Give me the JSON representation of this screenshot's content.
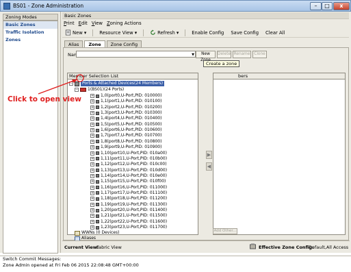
{
  "window": {
    "title": "BS01 - Zone Administration",
    "min_label": "–",
    "max_label": "□",
    "close_label": "x"
  },
  "left_panel": {
    "header": "Zoning Modes",
    "items": [
      {
        "label": "Basic Zones"
      },
      {
        "label": "Traffic Isolation Zones"
      }
    ]
  },
  "right_panel": {
    "header": "Basic Zones",
    "menu": [
      "Print",
      "Edit",
      "View",
      "Zoning Actions"
    ],
    "toolbar": {
      "new": "New",
      "resource_view": "Resource View",
      "refresh": "Refresh",
      "enable_config": "Enable Config",
      "save_config": "Save Config",
      "clear_all": "Clear All"
    },
    "tabs": [
      "Alias",
      "Zone",
      "Zone Config"
    ],
    "name_label": "Name",
    "buttons": {
      "new_zone": "New Zone",
      "delete": "Delete",
      "rename": "Rename",
      "clone": "Clone"
    },
    "member_selection": {
      "title": "Member Selection List",
      "root": "Ports & Attached Devices(24 Members)",
      "switch": "1(BS01)(24 Ports)",
      "ports": [
        "1,0(port0,U-Port,PID: 010000)",
        "1,1(port1,U-Port,PID: 010100)",
        "1,2(port2,U-Port,PID: 010200)",
        "1,3(port3,U-Port,PID: 010300)",
        "1,4(port4,U-Port,PID: 010400)",
        "1,5(port5,U-Port,PID: 010500)",
        "1,6(port6,U-Port,PID: 010600)",
        "1,7(port7,U-Port,PID: 010700)",
        "1,8(port8,U-Port,PID: 010800)",
        "1,9(port9,U-Port,PID: 010900)",
        "1,10(port10,U-Port,PID: 010a00)",
        "1,11(port11,U-Port,PID: 010b00)",
        "1,12(port12,U-Port,PID: 010c00)",
        "1,13(port13,U-Port,PID: 010d00)",
        "1,14(port14,U-Port,PID: 010e00)",
        "1,15(port15,U-Port,PID: 010f00)",
        "1,16(port16,U-Port,PID: 011000)",
        "1,17(port17,U-Port,PID: 011100)",
        "1,18(port18,U-Port,PID: 011200)",
        "1,19(port19,U-Port,PID: 011300)",
        "1,20(port20,U-Port,PID: 011400)",
        "1,21(port21,U-Port,PID: 011500)",
        "1,22(port22,U-Port,PID: 011600)",
        "1,23(port23,U-Port,PID: 011700)"
      ],
      "wwns": "WWNs (0 Devices)",
      "aliases": "Aliases"
    },
    "members_header": "bers",
    "tooltip": "Create a zone",
    "add_other": "Add Other...",
    "current_view_label": "Current View:",
    "current_view_value": "Fabric View",
    "effective_label": "Effective Zone Config:",
    "effective_value": "Default,All Access"
  },
  "bottom": {
    "line1": "Switch Commit Messages:",
    "line2": "Zone Admin opened at Fri Feb 06 2015 22:08:48 GMT+00:00"
  },
  "annotation": "Click to open view",
  "colors": {
    "accent_select": "#3b5fa8",
    "annotation": "#e02020",
    "link_blue": "#1f4a8c"
  }
}
